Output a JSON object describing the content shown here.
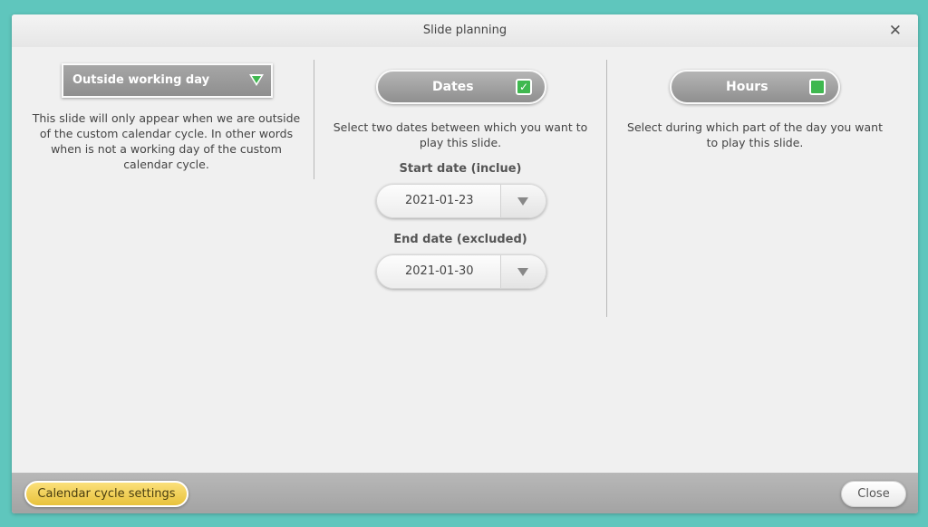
{
  "dialog": {
    "title": "Slide planning",
    "close_icon": "close-icon"
  },
  "left": {
    "mode_label": "Outside working day",
    "mode_icon": "triangle-down-icon",
    "description": "This slide will only appear when we are outside of the custom calendar cycle. In other words when is not a working day of the custom calendar cycle."
  },
  "center": {
    "toggle_label": "Dates",
    "toggle_checked": true,
    "description": "Select two dates between which you want to play this slide.",
    "start_label": "Start date (inclue)",
    "start_value": "2021-01-23",
    "end_label": "End date (excluded)",
    "end_value": "2021-01-30"
  },
  "right": {
    "toggle_label": "Hours",
    "toggle_checked": false,
    "description": "Select during which part of the day you want to play this slide."
  },
  "footer": {
    "calendar_button": "Calendar cycle settings",
    "close_button": "Close"
  },
  "colors": {
    "background": "#5fc6bd",
    "accent_green": "#3fb84f",
    "accent_yellow": "#f2cf55"
  }
}
